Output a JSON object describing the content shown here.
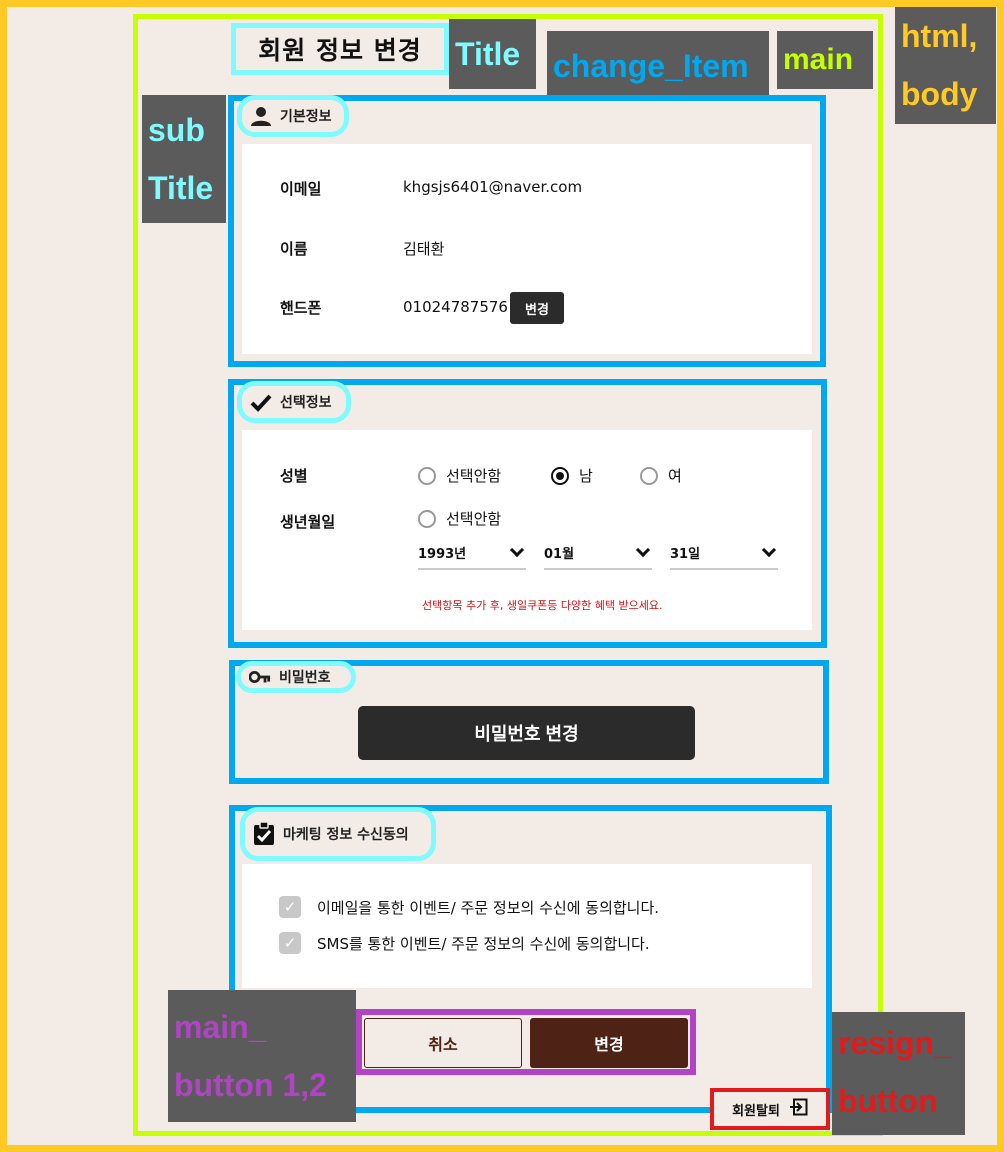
{
  "annotations": {
    "html_body": [
      "html,",
      "body"
    ],
    "main": "main",
    "title": "Title",
    "change_item": "change_Item",
    "sub_title": [
      "sub",
      "Title"
    ],
    "main_button": [
      "main_",
      "button 1,2"
    ],
    "resign_button": [
      "resign_",
      "button"
    ]
  },
  "page": {
    "title": "회원 정보 변경"
  },
  "basic_info": {
    "subtitle": "기본정보",
    "email_label": "이메일",
    "email_value": "khgsjs6401@naver.com",
    "name_label": "이름",
    "name_value": "김태환",
    "phone_label": "핸드폰",
    "phone_value": "01024787576",
    "phone_change_button": "변경"
  },
  "optional_info": {
    "subtitle": "선택정보",
    "gender_label": "성별",
    "gender_options": [
      "선택안함",
      "남",
      "여"
    ],
    "gender_selected": "남",
    "birth_label": "생년월일",
    "birth_option": "선택안함",
    "year": "1993년",
    "month": "01월",
    "day": "31일",
    "notice": "선택항목 추가 후, 생일쿠폰등 다양한 혜택 받으세요."
  },
  "password": {
    "subtitle": "비밀번호",
    "change_button": "비밀번호 변경"
  },
  "marketing": {
    "subtitle": "마케팅 정보 수신동의",
    "email_consent": "이메일을 통한 이벤트/ 주문 정보의 수신에 동의합니다.",
    "sms_consent": "SMS를 통한 이벤트/ 주문 정보의 수신에 동의합니다."
  },
  "buttons": {
    "cancel": "취소",
    "change": "변경",
    "resign": "회원탈퇴"
  },
  "colors": {
    "background_outer": "#ffc926",
    "background_page": "#f3ebe6",
    "main_border": "#c6ff00",
    "section_border": "#00a8f0",
    "subtitle_border": "#7ffaff",
    "button_border": "#b044c4",
    "resign_border": "#e11b1b",
    "change_button": "#4e2215",
    "dark_button": "#2b2b2b",
    "notice": "#d01010"
  }
}
